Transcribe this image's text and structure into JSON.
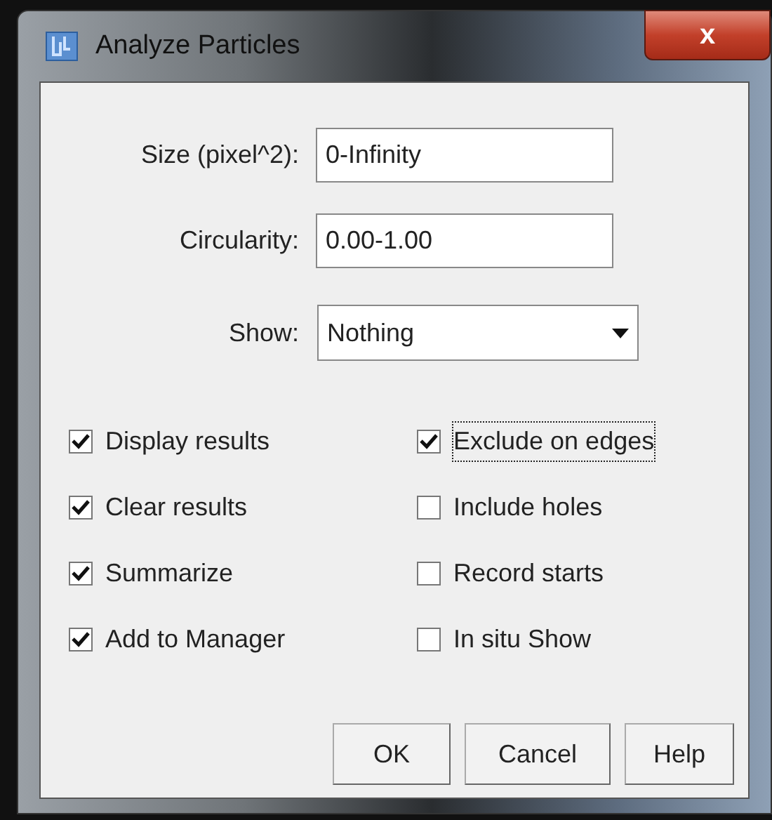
{
  "window": {
    "title": "Analyze Particles",
    "close": "x"
  },
  "fields": [
    {
      "label": "Size (pixel^2):",
      "value": "0-Infinity"
    },
    {
      "label": "Circularity:",
      "value": "0.00-1.00"
    }
  ],
  "show": {
    "label": "Show:",
    "value": "Nothing"
  },
  "checkboxes": [
    {
      "label": "Display results",
      "checked": true,
      "focused": false
    },
    {
      "label": "Exclude on edges",
      "checked": true,
      "focused": true
    },
    {
      "label": "Clear results",
      "checked": true,
      "focused": false
    },
    {
      "label": "Include holes",
      "checked": false,
      "focused": false
    },
    {
      "label": "Summarize",
      "checked": true,
      "focused": false
    },
    {
      "label": "Record starts",
      "checked": false,
      "focused": false
    },
    {
      "label": "Add to Manager",
      "checked": true,
      "focused": false
    },
    {
      "label": "In situ Show",
      "checked": false,
      "focused": false
    }
  ],
  "buttons": [
    "OK",
    "Cancel",
    "Help"
  ]
}
